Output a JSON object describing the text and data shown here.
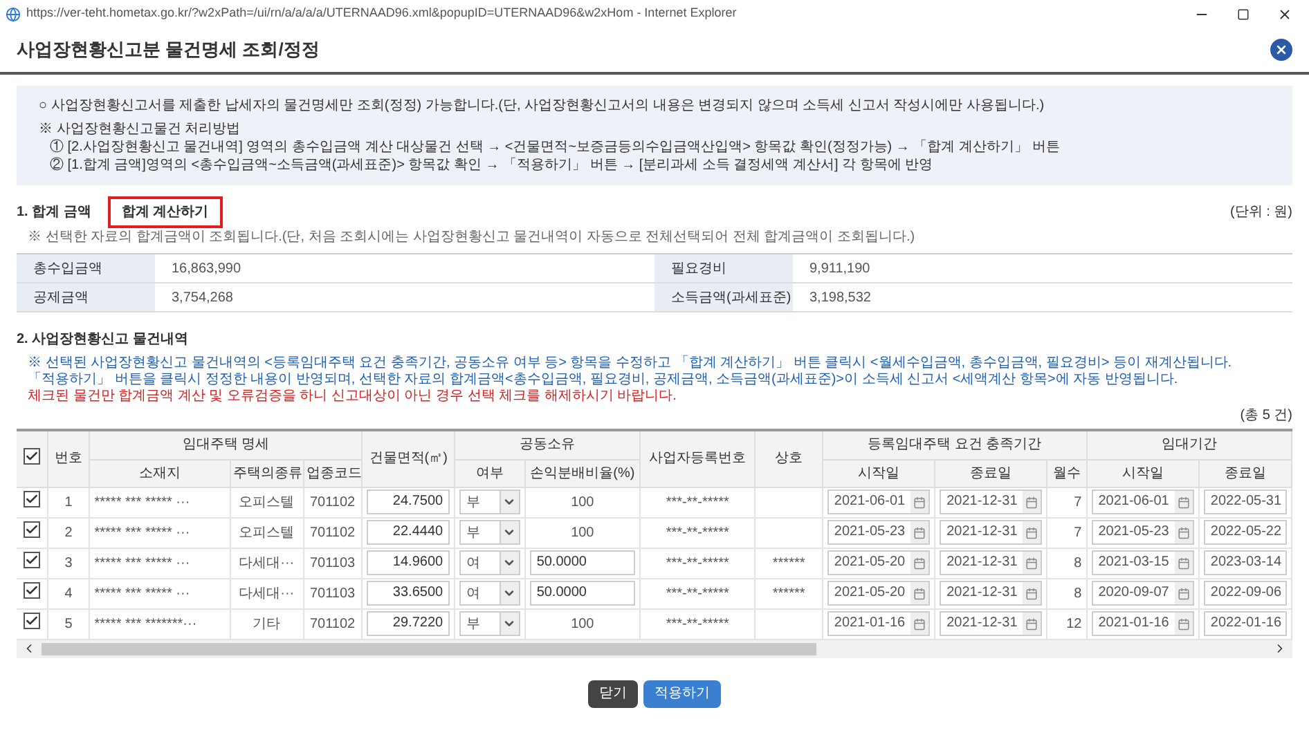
{
  "browser": {
    "title": "https://ver-teht.hometax.go.kr/?w2xPath=/ui/rn/a/a/a/a/UTERNAAD96.xml&popupID=UTERNAAD96&w2xHom - Internet Explorer"
  },
  "dialog": {
    "title": "사업장현황신고분 물건명세 조회/정정"
  },
  "guide": {
    "lines": [
      {
        "kind": "bullet",
        "text": "○ 사업장현황신고서를 제출한 납세자의 물건명세만 조회(정정) 가능합니다.(단, 사업장현황신고서의 내용은 변경되지 않으며 소득세 신고서 작성시에만 사용됩니다.)"
      },
      {
        "kind": "heading",
        "text": "※ 사업장현황신고물건 처리방법"
      },
      {
        "kind": "step",
        "text": "① [2.사업장현황신고 물건내역] 영역의 총수입금액 계산 대상물건 선택 → <건물면적~보증금등의수입금액산입액> 항목값 확인(정정가능) → 「합계 계산하기」 버튼"
      },
      {
        "kind": "step",
        "text": "② [1.합계 금액]영역의 <총수입금액~소득금액(과세표준)> 항목값 확인 → 「적용하기」 버튼 → [분리과세 소득 결정세액 계산서] 각 항목에 반영"
      }
    ]
  },
  "total_section": {
    "heading": "1. 합계 금액",
    "calc_button": {
      "label": "합계 계산하기",
      "highlighted": true
    },
    "unit": "(단위 : 원)",
    "note": "※ 선택한 자료의 합계금액이 조회됩니다.(단, 처음 조회시에는 사업장현황신고 물건내역이 자동으로 전체선택되어 전체 합계금액이 조회됩니다.)",
    "rows": [
      [
        {
          "label": "총수입금액",
          "value": "16,863,990"
        },
        {
          "label": "필요경비",
          "value": "9,911,190"
        }
      ],
      [
        {
          "label": "공제금액",
          "value": "3,754,268"
        },
        {
          "label": "소득금액(과세표준)",
          "value": "3,198,532"
        }
      ]
    ]
  },
  "items_section": {
    "heading": "2. 사업장현황신고 물건내역",
    "notes": [
      {
        "color": "#1f5fb4",
        "text": "※ 선택된 사업장현황신고 물건내역의 <등록임대주택 요건 충족기간, 공동소유 여부 등> 항목을 수정하고 「합계 계산하기」 버튼 클릭시 <월세수입금액, 총수입금액, 필요경비> 등이 재계산됩니다."
      },
      {
        "color": "#1f5fb4",
        "text": "「적용하기」 버튼을 클릭시 정정한 내용이 반영되며, 선택한 자료의 합계금액<총수입금액, 필요경비, 공제금액, 소득금액(과세표준)>이 소득세 신고서 <세액계산 항목>에 자동 반영됩니다."
      },
      {
        "color": "#d42020",
        "text": "체크된 물건만 합계금액 계산 및 오류검증을 하니 신고대상이 아닌 경우 선택 체크를 해제하시기 바랍니다."
      }
    ],
    "count": "(총 5 건)",
    "table": {
      "all_checked": true,
      "group_headers": [
        "번호",
        "임대주택 명세",
        "건물면적(㎡)",
        "공동소유",
        "사업자등록번호",
        "상호",
        "등록임대주택 요건 충족기간",
        "임대기간"
      ],
      "sub_headers": [
        "소재지",
        "주택의종류",
        "업종코드",
        "여부",
        "손익분배비율(%)",
        "시작일",
        "종료일",
        "월수",
        "시작일",
        "종료일"
      ],
      "rows": [
        {
          "checked": true,
          "no": "1",
          "address": "***** *** ***** ···",
          "type": "오피스텔",
          "code": "701102",
          "area": "24.7500",
          "joint": "부",
          "share": {
            "kind": "text",
            "value": "100"
          },
          "bizno": "***-**-*****",
          "name": "",
          "req_start": "2021-06-01",
          "req_end": "2021-12-31",
          "months": "7",
          "lease_start": "2021-06-01",
          "lease_end": "2022-05-31"
        },
        {
          "checked": true,
          "no": "2",
          "address": "***** *** ***** ···",
          "type": "오피스텔",
          "code": "701102",
          "area": "22.4440",
          "joint": "부",
          "share": {
            "kind": "text",
            "value": "100"
          },
          "bizno": "***-**-*****",
          "name": "",
          "req_start": "2021-05-23",
          "req_end": "2021-12-31",
          "months": "7",
          "lease_start": "2021-05-23",
          "lease_end": "2022-05-22"
        },
        {
          "checked": true,
          "no": "3",
          "address": "***** *** ***** ···",
          "type": "다세대···",
          "code": "701103",
          "area": "14.9600",
          "joint": "여",
          "share": {
            "kind": "input",
            "value": "50.0000"
          },
          "bizno": "***-**-*****",
          "name": "******",
          "req_start": "2021-05-20",
          "req_end": "2021-12-31",
          "months": "8",
          "lease_start": "2021-03-15",
          "lease_end": "2023-03-14"
        },
        {
          "checked": true,
          "no": "4",
          "address": "***** *** ***** ···",
          "type": "다세대···",
          "code": "701103",
          "area": "33.6500",
          "joint": "여",
          "share": {
            "kind": "input",
            "value": "50.0000"
          },
          "bizno": "***-**-*****",
          "name": "******",
          "req_start": "2021-05-20",
          "req_end": "2021-12-31",
          "months": "8",
          "lease_start": "2020-09-07",
          "lease_end": "2022-09-06"
        },
        {
          "checked": true,
          "no": "5",
          "address": "***** *** *******···",
          "type": "기타",
          "code": "701102",
          "area": "29.7220",
          "joint": "부",
          "share": {
            "kind": "text",
            "value": "100"
          },
          "bizno": "***-**-*****",
          "name": "",
          "req_start": "2021-01-16",
          "req_end": "2021-12-31",
          "months": "12",
          "lease_start": "2021-01-16",
          "lease_end": "2022-01-16"
        }
      ]
    }
  },
  "buttons": [
    {
      "kind": "dark",
      "label": "닫기"
    },
    {
      "kind": "primary",
      "label": "적용하기"
    }
  ]
}
